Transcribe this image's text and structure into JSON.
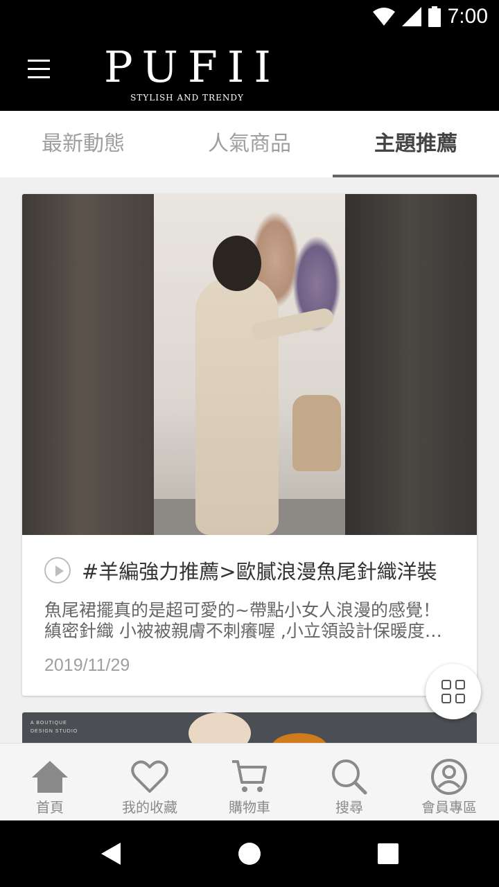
{
  "status_bar": {
    "time": "7:00"
  },
  "header": {
    "logo_text": "PUFII",
    "logo_tagline": "STYLISH AND TRENDY"
  },
  "tabs": [
    {
      "label": "最新動態",
      "active": false
    },
    {
      "label": "人氣商品",
      "active": false
    },
    {
      "label": "主題推薦",
      "active": true
    }
  ],
  "feed": {
    "cards": [
      {
        "title": "#羊編強力推薦>歐膩浪漫魚尾針織洋裝",
        "description_line1": "魚尾裙擺真的是超可愛的~帶點小女人浪漫的感覺！",
        "description_line2": "縝密針織 小被被親膚不刺癢喔 ,小立領設計保暖度一級棒",
        "date": "2019/11/29"
      }
    ],
    "next_card_caption_line1": "A BOUTIQUE",
    "next_card_caption_line2": "DESIGN STUDIO"
  },
  "bottom_nav": [
    {
      "label": "首頁",
      "icon": "home-icon"
    },
    {
      "label": "我的收藏",
      "icon": "heart-icon"
    },
    {
      "label": "購物車",
      "icon": "cart-icon"
    },
    {
      "label": "搜尋",
      "icon": "search-icon"
    },
    {
      "label": "會員專區",
      "icon": "account-icon"
    }
  ],
  "colors": {
    "header_bg": "#000000",
    "active_tab": "#444444",
    "inactive_tab": "#9e9e9e",
    "nav_icon": "#8a8a8a"
  }
}
